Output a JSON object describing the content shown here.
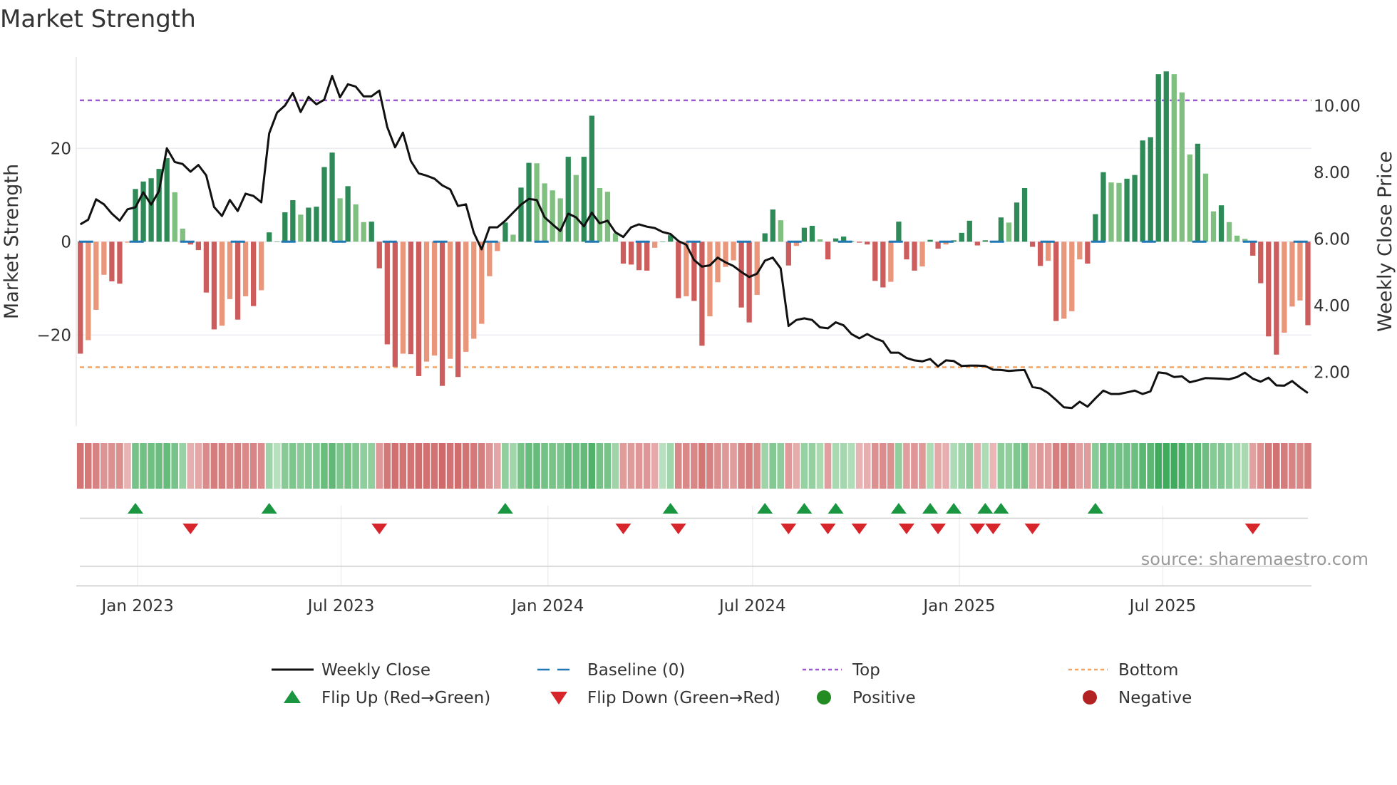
{
  "title": "Market Strength",
  "source": "source: sharemaestro.com",
  "colors": {
    "pos_strong": "#2e8b57",
    "pos_weak": "#7fbf7f",
    "neg_strong": "#cd5c5c",
    "neg_weak": "#e9967a",
    "close": "#111111",
    "baseline": "#1f77b4",
    "top": "#9b59d0",
    "bottom": "#f4a460",
    "flip_up": "#1a9641",
    "flip_down": "#d7262b",
    "positive": "#228b22",
    "negative": "#b22222"
  },
  "chart_data": {
    "type": "bar",
    "title": "Market Strength",
    "frequency": "weekly",
    "start_date": "2022-11-11",
    "ylabel": "Market Strength",
    "y2label": "Weekly Close Price",
    "ylim": [
      -40,
      40
    ],
    "y2lim": [
      0.5,
      11.5
    ],
    "yticks": [
      "20",
      "0",
      "−20"
    ],
    "ytick_values": [
      20,
      0,
      -20
    ],
    "y2ticks": [
      "10.00",
      "8.00",
      "6.00",
      "4.00",
      "2.00"
    ],
    "y2tick_values": [
      10,
      8,
      6,
      4,
      2
    ],
    "xticks": [
      {
        "label": "Jan 2023",
        "date": "2023-01-01"
      },
      {
        "label": "Jul 2023",
        "date": "2023-07-01"
      },
      {
        "label": "Jan 2024",
        "date": "2024-01-01"
      },
      {
        "label": "Jul 2024",
        "date": "2024-07-01"
      },
      {
        "label": "Jan 2025",
        "date": "2025-01-01"
      },
      {
        "label": "Jul 2025",
        "date": "2025-07-01"
      }
    ],
    "top_level": 30.3,
    "bottom_level": -26.9,
    "baseline": 0,
    "strength": [
      -24.0,
      -21.1,
      -14.6,
      -7.1,
      -8.5,
      -9.0,
      -0.2,
      11.3,
      12.9,
      13.6,
      15.6,
      17.9,
      10.6,
      2.8,
      -0.6,
      -1.8,
      -10.9,
      -18.8,
      -18.0,
      -12.3,
      -16.7,
      -11.7,
      -13.8,
      -10.4,
      2.0,
      0,
      6.3,
      8.9,
      5.8,
      7.3,
      7.5,
      16.0,
      19.1,
      9.3,
      11.9,
      8.0,
      4.2,
      4.3,
      -5.7,
      -22.0,
      -26.8,
      -24.0,
      -24.1,
      -28.8,
      -25.7,
      -24.4,
      -30.9,
      -25.1,
      -29.0,
      -23.6,
      -20.8,
      -17.6,
      -7.4,
      -2.0,
      4.1,
      1.5,
      11.6,
      16.9,
      16.8,
      12.5,
      11.0,
      9.3,
      18.2,
      14.3,
      18.2,
      27.0,
      11.5,
      10.7,
      1.8,
      -4.7,
      -4.9,
      -6.1,
      -6.2,
      -1.3,
      0,
      1.4,
      -12.1,
      -11.7,
      -12.7,
      -22.3,
      -16.0,
      -8.7,
      -5.4,
      -4.0,
      -14.1,
      -17.3,
      -11.4,
      1.8,
      6.9,
      4.6,
      -5.1,
      -0.9,
      3.0,
      3.4,
      0.5,
      -3.8,
      0.7,
      1.1,
      0.2,
      -0.2,
      -0.6,
      -8.4,
      -9.8,
      -8.6,
      4.3,
      -3.8,
      -6.2,
      -5.3,
      0.4,
      -1.5,
      -0.6,
      0.3,
      1.9,
      4.5,
      -0.8,
      0.3,
      -0.1,
      5.2,
      4.1,
      8.4,
      11.5,
      -1.1,
      -5.2,
      -4.1,
      -17.0,
      -16.5,
      -14.9,
      -3.8,
      -4.7,
      5.9,
      14.9,
      12.7,
      12.6,
      13.5,
      14.3,
      21.7,
      22.4,
      35.9,
      36.5,
      35.9,
      32.0,
      18.7,
      21.0,
      14.6,
      6.5,
      7.8,
      4.2,
      1.3,
      0.6,
      -3.0,
      -8.9,
      -20.3,
      -24.2,
      -19.5,
      -13.9,
      -12.6,
      -17.9
    ],
    "weekly_close": [
      6.44,
      6.58,
      7.19,
      7.04,
      6.76,
      6.55,
      6.89,
      6.95,
      7.4,
      7.03,
      7.44,
      8.72,
      8.31,
      8.25,
      8.02,
      8.22,
      7.91,
      6.96,
      6.69,
      7.17,
      6.84,
      7.36,
      7.29,
      7.1,
      9.17,
      9.79,
      10.0,
      10.38,
      9.81,
      10.26,
      10.04,
      10.18,
      10.89,
      10.25,
      10.64,
      10.57,
      10.28,
      10.28,
      10.45,
      9.36,
      8.75,
      9.19,
      8.34,
      7.97,
      7.9,
      7.81,
      7.61,
      7.49,
      6.99,
      7.04,
      6.19,
      5.69,
      6.35,
      6.35,
      6.55,
      6.79,
      7.03,
      7.2,
      7.17,
      6.65,
      6.44,
      6.24,
      6.76,
      6.65,
      6.38,
      6.79,
      6.47,
      6.55,
      6.2,
      6.06,
      6.35,
      6.44,
      6.37,
      6.33,
      6.21,
      6.15,
      5.94,
      5.83,
      5.37,
      5.17,
      5.21,
      5.44,
      5.3,
      5.19,
      5.01,
      4.86,
      4.96,
      5.35,
      5.44,
      5.12,
      3.39,
      3.57,
      3.62,
      3.57,
      3.35,
      3.32,
      3.5,
      3.41,
      3.15,
      3.02,
      3.15,
      3.02,
      2.93,
      2.59,
      2.59,
      2.43,
      2.36,
      2.33,
      2.4,
      2.18,
      2.36,
      2.34,
      2.19,
      2.2,
      2.2,
      2.19,
      2.08,
      2.07,
      2.04,
      2.06,
      2.07,
      1.56,
      1.52,
      1.38,
      1.17,
      0.95,
      0.93,
      1.12,
      0.97,
      1.22,
      1.45,
      1.35,
      1.35,
      1.4,
      1.45,
      1.35,
      1.43,
      2.0,
      1.97,
      1.86,
      1.88,
      1.7,
      1.76,
      1.83,
      1.82,
      1.81,
      1.79,
      1.86,
      1.99,
      1.81,
      1.72,
      1.84,
      1.61,
      1.6,
      1.74,
      1.55,
      1.38
    ],
    "legend_placement": "bottom-center"
  },
  "legend": [
    {
      "label": "Weekly Close"
    },
    {
      "label": "Baseline (0)"
    },
    {
      "label": "Top"
    },
    {
      "label": "Bottom"
    },
    {
      "label": "Flip Up (Red→Green)"
    },
    {
      "label": "Flip Down (Green→Red)"
    },
    {
      "label": "Positive"
    },
    {
      "label": "Negative"
    }
  ]
}
